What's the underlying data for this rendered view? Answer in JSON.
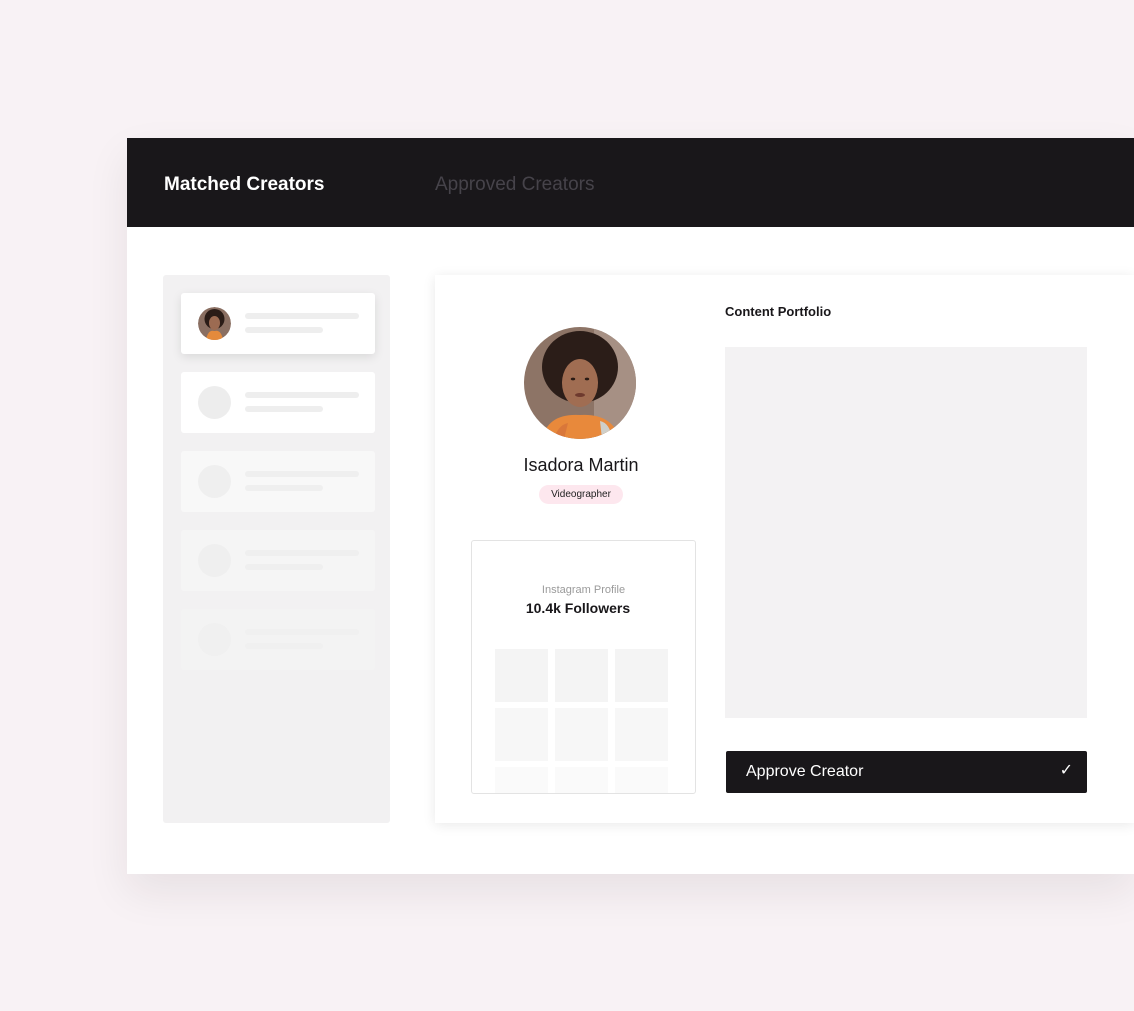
{
  "tabs": {
    "matched": "Matched Creators",
    "approved": "Approved Creators"
  },
  "creator": {
    "name": "Isadora Martin",
    "role": "Videographer"
  },
  "instagram": {
    "label": "Instagram Profile",
    "followers": "10.4k Followers"
  },
  "portfolio": {
    "title": "Content Portfolio"
  },
  "actions": {
    "approve_label": "Approve Creator",
    "approve_icon": "checkmark-icon"
  },
  "colors": {
    "background": "#f8f2f5",
    "topbar": "#19171a",
    "accent_pill": "#fde7ee",
    "button": "#19171a"
  }
}
